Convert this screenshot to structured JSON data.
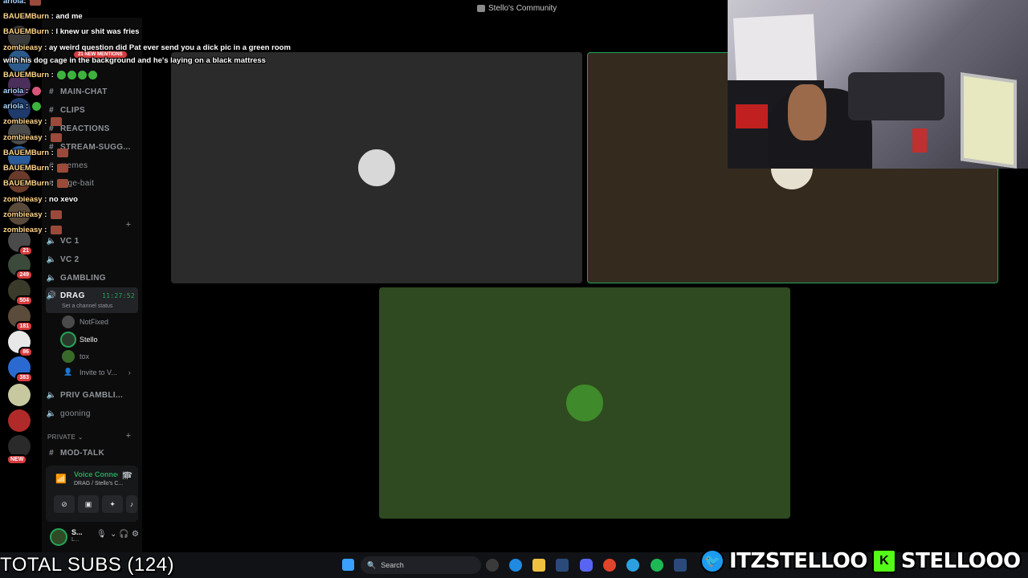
{
  "window": {
    "title": "Stello's Community"
  },
  "server_rail": {
    "badges": [
      "21",
      "249",
      "504",
      "181",
      "86",
      "383"
    ],
    "new_badge": "NEW"
  },
  "sidebar": {
    "mentions_pill": "21 NEW MENTIONS",
    "channels": [
      {
        "label": "MAIN-CHAT",
        "icon": "hash-icon"
      },
      {
        "label": "CLIPS",
        "icon": "hash-icon"
      },
      {
        "label": "REACTIONS",
        "icon": "hash-icon"
      },
      {
        "label": "STREAM-SUGG...",
        "icon": "hash-icon"
      },
      {
        "label": "memes",
        "icon": "hash-icon"
      },
      {
        "label": "rage-bait",
        "icon": "hash-icon"
      }
    ],
    "voice_channels": [
      {
        "label": "VC 1"
      },
      {
        "label": "VC 2"
      },
      {
        "label": "GAMBLING"
      },
      {
        "label": "DRAG",
        "timer": "11:27:52",
        "status": "Set a channel status"
      }
    ],
    "members": [
      {
        "name": "NotFixed"
      },
      {
        "name": "Stello"
      },
      {
        "name": "tox"
      }
    ],
    "invite_label": "Invite to V...",
    "more_channels": [
      {
        "label": "PRIV GAMBLI...",
        "icon": "speaker-icon"
      },
      {
        "label": "gooning",
        "icon": "speaker-icon"
      }
    ],
    "category_private": "PRIVATE",
    "mod_channel": "MOD-TALK",
    "voice_panel": {
      "status": "Voice Connected",
      "sub": "DRAG / Stello's C..."
    },
    "user_panel": {
      "name": "S...",
      "status": "L..."
    }
  },
  "chat_overlay": [
    {
      "user": "ariola",
      "text": ":"
    },
    {
      "user": "BAUEMBurn",
      "text": ": and me"
    },
    {
      "user": "BAUEMBurn",
      "text": ": I knew ur shit was fries"
    },
    {
      "user": "zombieasy",
      "text": ": ay weird question did Pat ever send you a dick pic in a green room"
    },
    {
      "user": "",
      "text": "with his dog cage in the background and he's laying on a black mattress"
    },
    {
      "user": "BAUEMBurn",
      "text": ":"
    },
    {
      "user": "ariola",
      "text": ":"
    },
    {
      "user": "ariola",
      "text": ":"
    },
    {
      "user": "zombieasy",
      "text": ":"
    },
    {
      "user": "zombieasy",
      "text": ":"
    },
    {
      "user": "BAUEMBurn",
      "text": ":"
    },
    {
      "user": "BAUEMBurn",
      "text": ":"
    },
    {
      "user": "BAUEMBurn",
      "text": ":"
    },
    {
      "user": "zombieasy",
      "text": ": no xevo"
    },
    {
      "user": "zombieasy",
      "text": ":"
    },
    {
      "user": "zombieasy",
      "text": ":"
    }
  ],
  "colors": {
    "tile_dark": "#2b2b2b",
    "tile_brown": "#342a1e",
    "tile_green": "#2f4a21",
    "speaking_border": "#23a55a"
  },
  "taskbar": {
    "search_placeholder": "Search"
  },
  "overlay": {
    "subs": "TOTAL SUBS (124)",
    "twitter": "ITZSTELLOO",
    "kick": "STELLOOO"
  }
}
